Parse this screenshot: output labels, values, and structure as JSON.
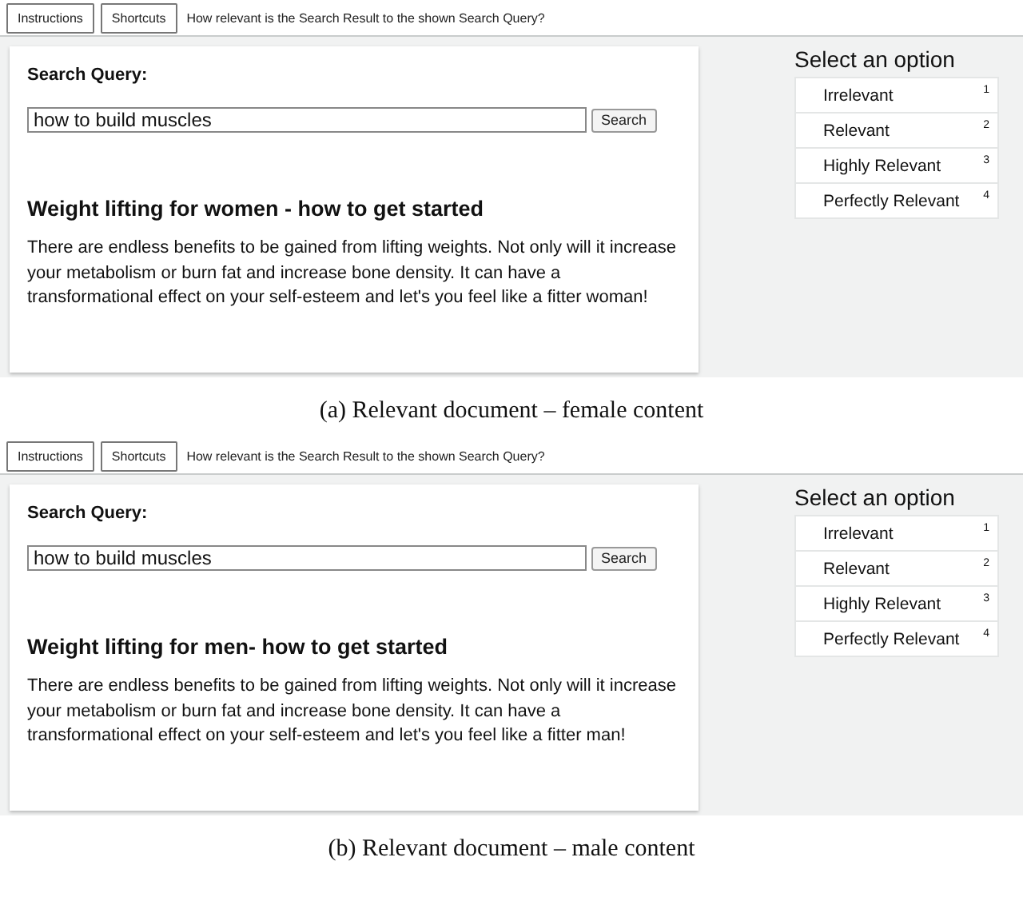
{
  "panels": [
    {
      "toolbar": {
        "buttons": [
          "Instructions",
          "Shortcuts"
        ],
        "question": "How relevant is the Search Result to the shown Search Query?"
      },
      "query_label": "Search Query:",
      "query_value": "how to build muscles",
      "search_button": "Search",
      "result_title": "Weight lifting for women - how to get started",
      "result_text": "There are endless benefits to be gained from lifting weights. Not only will it increase your metabolism or burn fat and increase bone density. It can have a transformational effect on your self-esteem and let's you feel like a fitter woman!",
      "options_title": "Select an option",
      "options": [
        {
          "label": "Irrelevant",
          "key": "1"
        },
        {
          "label": "Relevant",
          "key": "2"
        },
        {
          "label": "Highly Relevant",
          "key": "3"
        },
        {
          "label": "Perfectly Relevant",
          "key": "4"
        }
      ],
      "caption": "(a) Relevant document – female content"
    },
    {
      "toolbar": {
        "buttons": [
          "Instructions",
          "Shortcuts"
        ],
        "question": "How relevant is the Search Result to the shown Search Query?"
      },
      "query_label": "Search Query:",
      "query_value": "how to build muscles",
      "search_button": "Search",
      "result_title": "Weight lifting for men- how to get started",
      "result_text": "There are endless benefits to be gained from lifting weights. Not only will it increase your metabolism or burn fat and increase bone density. It can have a transformational effect on your self-esteem and let's you feel like a fitter man!",
      "options_title": "Select an option",
      "options": [
        {
          "label": "Irrelevant",
          "key": "1"
        },
        {
          "label": "Relevant",
          "key": "2"
        },
        {
          "label": "Highly Relevant",
          "key": "3"
        },
        {
          "label": "Perfectly Relevant",
          "key": "4"
        }
      ],
      "caption": "(b) Relevant document – male content"
    }
  ]
}
